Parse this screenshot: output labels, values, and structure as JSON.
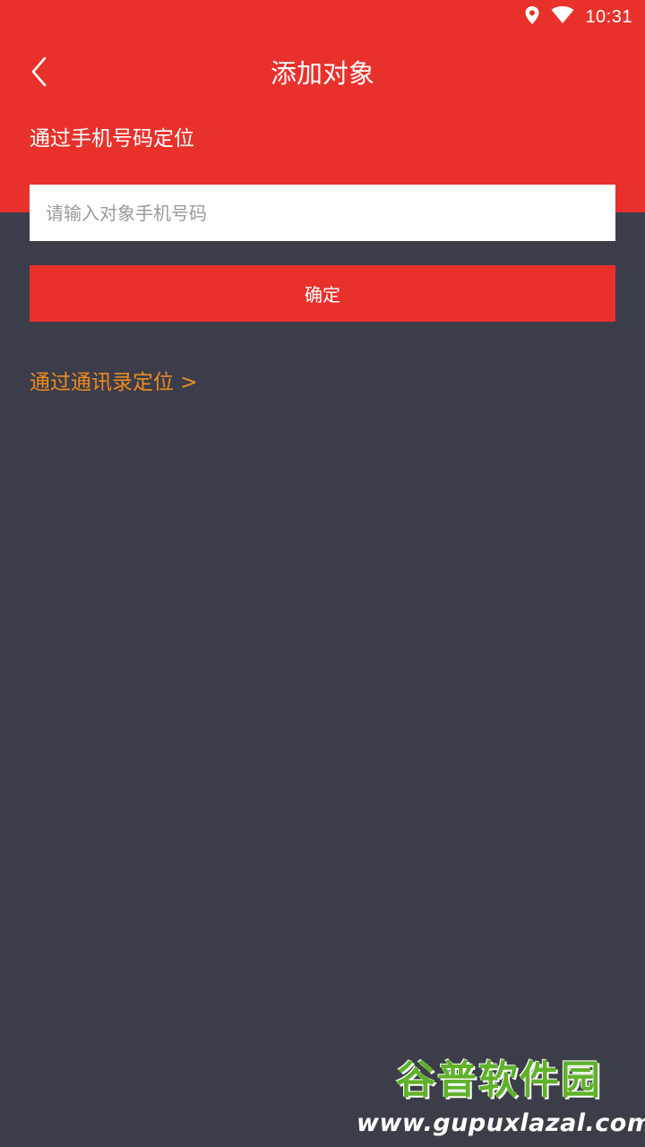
{
  "status_bar": {
    "time": "10:31",
    "icons": [
      "location-icon",
      "wifi-icon"
    ]
  },
  "header": {
    "title": "添加对象",
    "back_icon": "chevron-left-icon",
    "background_color": "#e8312b"
  },
  "form": {
    "section_label": "通过手机号码定位",
    "phone_placeholder": "请输入对象手机号码",
    "phone_value": "",
    "confirm_label": "确定",
    "accent_color": "#e8312b"
  },
  "links": {
    "contacts_label": "通过通讯录定位 >",
    "link_color": "#f08a1c"
  },
  "watermark": {
    "title": "谷普软件园",
    "url": "www.gupuxlazal.com"
  }
}
